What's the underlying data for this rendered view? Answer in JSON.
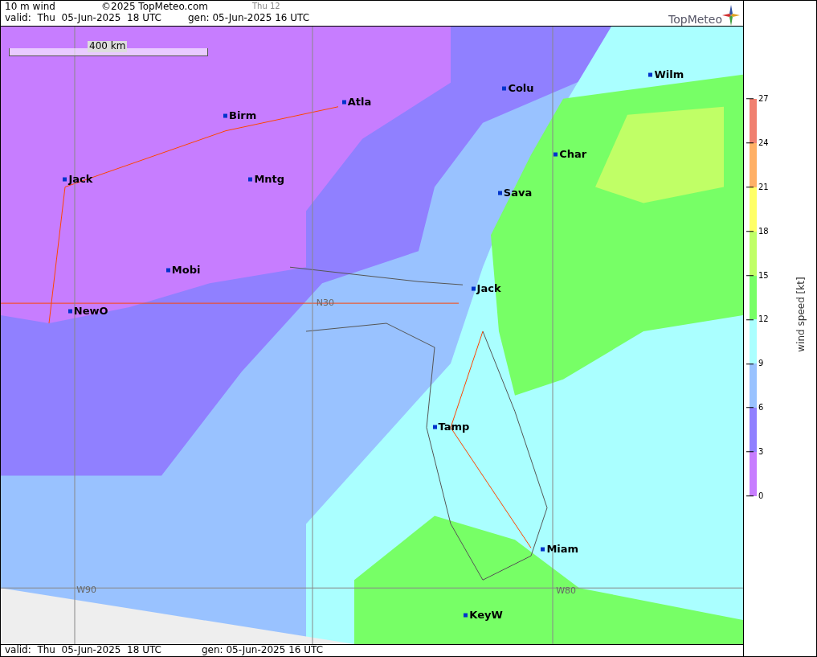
{
  "header": {
    "parameter": "10 m wind",
    "copyright": "©2025 TopMeteo.com",
    "step": "Thu 12",
    "valid": "valid:  Thu  05-Jun-2025  18 UTC",
    "generated": "gen: 05-Jun-2025 16 UTC",
    "logo": "TopMeteo"
  },
  "map": {
    "scale": "400 km",
    "grid_labels": [
      {
        "text": "N30"
      },
      {
        "text": "W90"
      },
      {
        "text": "W80"
      }
    ],
    "cities": [
      {
        "name": "Wilm"
      },
      {
        "name": "Colu"
      },
      {
        "name": "Atla"
      },
      {
        "name": "Birm"
      },
      {
        "name": "Char"
      },
      {
        "name": "Jack"
      },
      {
        "name": "Mntg"
      },
      {
        "name": "Sava"
      },
      {
        "name": "Mobi"
      },
      {
        "name": "Jack"
      },
      {
        "name": "NewO"
      },
      {
        "name": "Tamp"
      },
      {
        "name": "Miam"
      },
      {
        "name": "KeyW"
      }
    ]
  },
  "legend": {
    "title": "wind speed [kt]",
    "ticks": [
      "27",
      "24",
      "21",
      "18",
      "15",
      "12",
      "9",
      "6",
      "3",
      "0"
    ],
    "bands": [
      {
        "color": "#f08070"
      },
      {
        "color": "#ffb066"
      },
      {
        "color": "#ffff66"
      },
      {
        "color": "#c0ff66"
      },
      {
        "color": "#77ff66"
      },
      {
        "color": "#aaffff"
      },
      {
        "color": "#99c2ff"
      },
      {
        "color": "#9080ff"
      },
      {
        "color": "#c77dff"
      }
    ]
  },
  "footer": {
    "valid": "valid:  Thu  05-Jun-2025  18 UTC",
    "generated": "gen: 05-Jun-2025 16 UTC"
  }
}
